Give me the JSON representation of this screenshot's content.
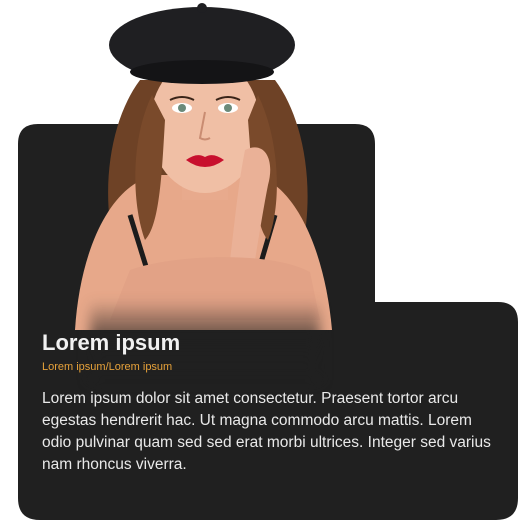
{
  "card": {
    "title": "Lorem ipsum",
    "subtitle": "Lorem ipsum/Lorem ipsum",
    "description": "Lorem ipsum dolor sit amet consectetur. Praesent tortor arcu egestas hendrerit hac. Ut magna commodo arcu mattis. Lorem odio pulvinar quam sed sed erat morbi ultrices. Integer sed varius nam rhoncus viverra."
  },
  "colors": {
    "card_background": "#202020",
    "title": "#f1f1f1",
    "subtitle_accent": "#e7a23a",
    "body_text": "#e9e9e9"
  },
  "media": {
    "portrait": "woman-in-black-beret-photo"
  }
}
